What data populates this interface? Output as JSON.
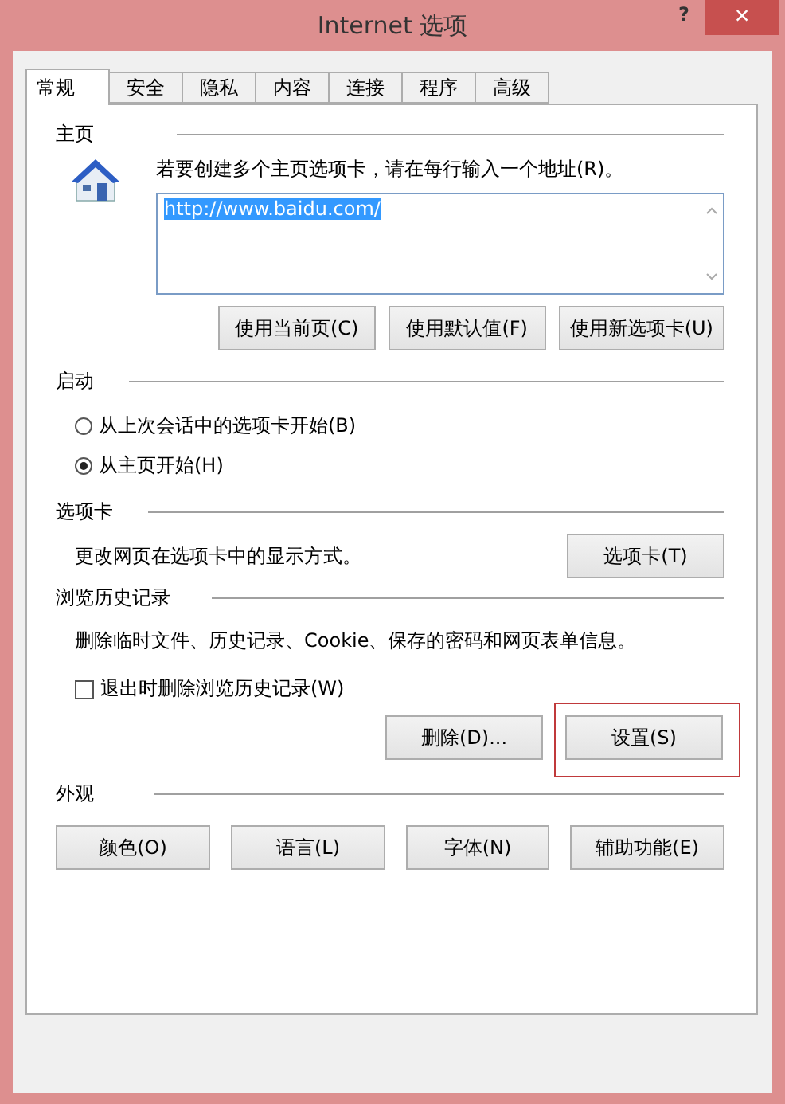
{
  "window": {
    "title": "Internet 选项",
    "help": "?",
    "close": "×"
  },
  "tabs": [
    {
      "label": "常规",
      "selected": true
    },
    {
      "label": "安全",
      "selected": false
    },
    {
      "label": "隐私",
      "selected": false
    },
    {
      "label": "内容",
      "selected": false
    },
    {
      "label": "连接",
      "selected": false
    },
    {
      "label": "程序",
      "selected": false
    },
    {
      "label": "高级",
      "selected": false
    }
  ],
  "homepage": {
    "heading": "主页",
    "instruction": "若要创建多个主页选项卡，请在每行输入一个地址(R)。",
    "value": "http://www.baidu.com/",
    "value_highlighted": true,
    "buttons": [
      {
        "label": "使用当前页(C)"
      },
      {
        "label": "使用默认值(F)"
      },
      {
        "label": "使用新选项卡(U)"
      }
    ]
  },
  "startup": {
    "heading": "启动",
    "options": [
      {
        "label": "从上次会话中的选项卡开始(B)",
        "selected": false
      },
      {
        "label": "从主页开始(H)",
        "selected": true
      }
    ]
  },
  "tabs_section": {
    "heading": "选项卡",
    "description": "更改网页在选项卡中的显示方式。",
    "button": "选项卡(T)"
  },
  "history": {
    "heading": "浏览历史记录",
    "description": "删除临时文件、历史记录、Cookie、保存的密码和网页表单信息。",
    "delete_on_exit": {
      "label": "退出时删除浏览历史记录(W)",
      "checked": false
    },
    "buttons": [
      {
        "label": "删除(D)...",
        "highlighted": false
      },
      {
        "label": "设置(S)",
        "highlighted": true
      }
    ]
  },
  "appearance": {
    "heading": "外观",
    "buttons": [
      {
        "label": "颜色(O)"
      },
      {
        "label": "语言(L)"
      },
      {
        "label": "字体(N)"
      },
      {
        "label": "辅助功能(E)"
      }
    ]
  }
}
